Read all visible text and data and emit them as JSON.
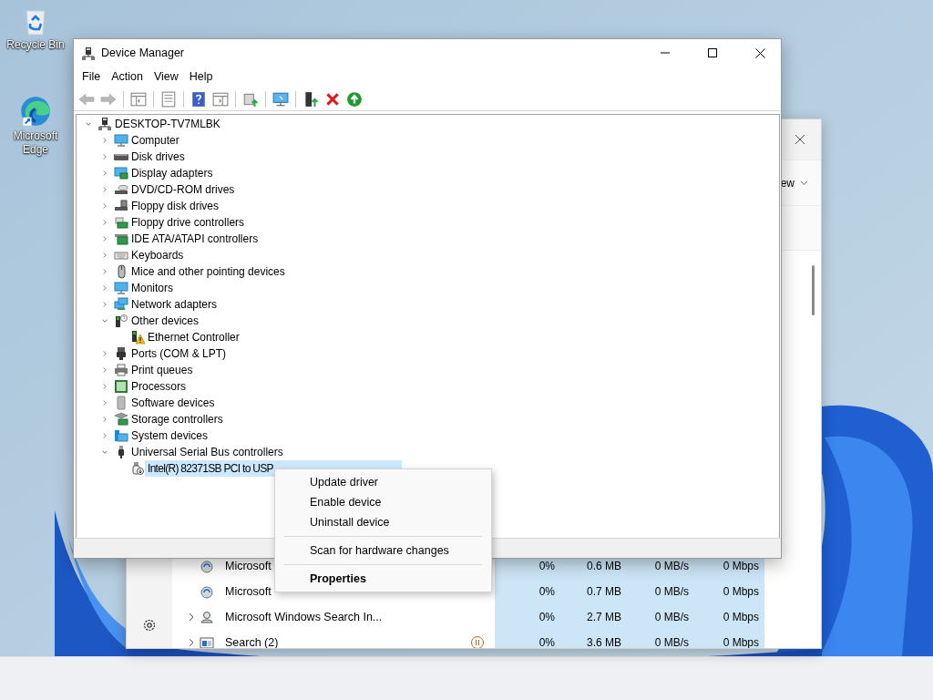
{
  "desktop_icons": [
    {
      "label": "Recycle Bin"
    },
    {
      "label": "Microsoft Edge"
    }
  ],
  "background_window": {
    "header_text": "ew",
    "rows": [
      {
        "name": "Microsoft",
        "expandable": false,
        "paused": false,
        "cpu": "0%",
        "memory": "0.6 MB",
        "disk": "0 MB/s",
        "network": "0 Mbps"
      },
      {
        "name": "Microsoft",
        "expandable": false,
        "paused": false,
        "cpu": "0%",
        "memory": "0.7 MB",
        "disk": "0 MB/s",
        "network": "0 Mbps"
      },
      {
        "name": "Microsoft Windows Search In...",
        "expandable": true,
        "paused": false,
        "cpu": "0%",
        "memory": "2.7 MB",
        "disk": "0 MB/s",
        "network": "0 Mbps"
      },
      {
        "name": "Search (2)",
        "expandable": true,
        "paused": true,
        "cpu": "0%",
        "memory": "3.6 MB",
        "disk": "0 MB/s",
        "network": "0 Mbps"
      }
    ]
  },
  "device_manager": {
    "title": "Device Manager",
    "menu": [
      "File",
      "Action",
      "View",
      "Help"
    ],
    "tree": {
      "label": "DESKTOP-TV7MLBK",
      "expanded": true,
      "selected": false,
      "children": [
        {
          "label": "Computer",
          "expanded": false,
          "selected": false
        },
        {
          "label": "Disk drives",
          "expanded": false,
          "selected": false
        },
        {
          "label": "Display adapters",
          "expanded": false,
          "selected": false
        },
        {
          "label": "DVD/CD-ROM drives",
          "expanded": false,
          "selected": false
        },
        {
          "label": "Floppy disk drives",
          "expanded": false,
          "selected": false
        },
        {
          "label": "Floppy drive controllers",
          "expanded": false,
          "selected": false
        },
        {
          "label": "IDE ATA/ATAPI controllers",
          "expanded": false,
          "selected": false
        },
        {
          "label": "Keyboards",
          "expanded": false,
          "selected": false
        },
        {
          "label": "Mice and other pointing devices",
          "expanded": false,
          "selected": false
        },
        {
          "label": "Monitors",
          "expanded": false,
          "selected": false
        },
        {
          "label": "Network adapters",
          "expanded": false,
          "selected": false
        },
        {
          "label": "Other devices",
          "expanded": true,
          "selected": false,
          "children": [
            {
              "label": "Ethernet Controller",
              "selected": false
            }
          ]
        },
        {
          "label": "Ports (COM & LPT)",
          "expanded": false,
          "selected": false
        },
        {
          "label": "Print queues",
          "expanded": false,
          "selected": false
        },
        {
          "label": "Processors",
          "expanded": false,
          "selected": false
        },
        {
          "label": "Software devices",
          "expanded": false,
          "selected": false
        },
        {
          "label": "Storage controllers",
          "expanded": false,
          "selected": false
        },
        {
          "label": "System devices",
          "expanded": false,
          "selected": false
        },
        {
          "label": "Universal Serial Bus controllers",
          "expanded": true,
          "selected": false,
          "children": [
            {
              "label": "Intel(R) 82371SB PCI to USP",
              "selected": true
            }
          ]
        }
      ]
    }
  },
  "context_menu": {
    "items": [
      {
        "kind": "item",
        "label": "Update driver",
        "default": false
      },
      {
        "kind": "item",
        "label": "Enable device",
        "default": false
      },
      {
        "kind": "item",
        "label": "Uninstall device",
        "default": false
      },
      {
        "kind": "separator"
      },
      {
        "kind": "item",
        "label": "Scan for hardware changes",
        "default": false
      },
      {
        "kind": "separator"
      },
      {
        "kind": "item",
        "label": "Properties",
        "default": true
      }
    ]
  }
}
